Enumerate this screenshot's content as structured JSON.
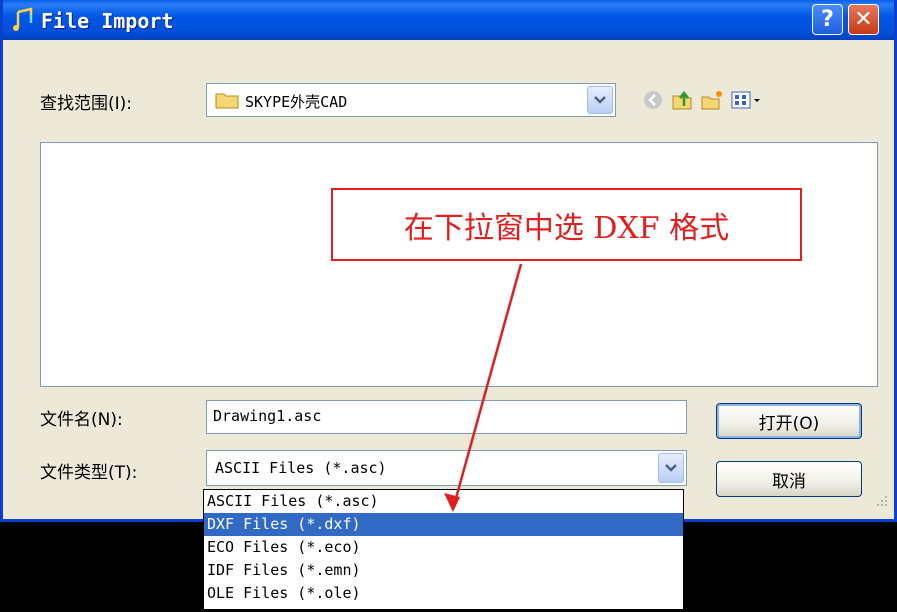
{
  "window": {
    "title": "File Import"
  },
  "lookin": {
    "label": "查找范围(I):",
    "value": "SKYPE外壳CAD"
  },
  "filename": {
    "label": "文件名(N):",
    "value": "Drawing1.asc"
  },
  "filetype": {
    "label": "文件类型(T):",
    "value": "ASCII Files (*.asc)",
    "options": [
      "ASCII Files (*.asc)",
      "DXF Files (*.dxf)",
      "ECO Files (*.eco)",
      "IDF Files (*.emn)",
      "OLE Files (*.ole)"
    ],
    "highlighted": "DXF Files (*.dxf)"
  },
  "buttons": {
    "open": "打开(O)",
    "cancel": "取消"
  },
  "annotation": {
    "text": "在下拉窗中选 DXF 格式",
    "color": "#E02020"
  },
  "colors": {
    "titlebar": "#0058E6",
    "dialog_bg": "#ECE9D8",
    "selection": "#316AC5"
  }
}
